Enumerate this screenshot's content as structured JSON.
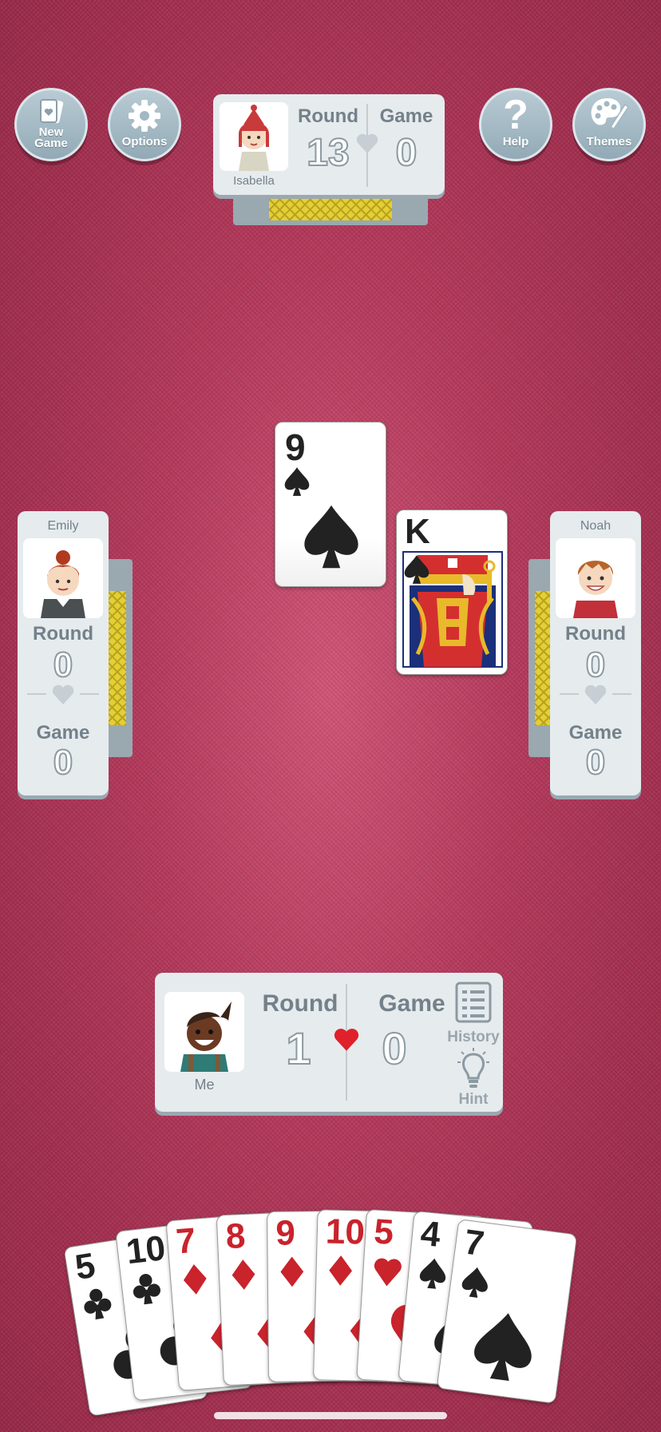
{
  "buttons": {
    "new_game": "New\nGame",
    "options": "Options",
    "help": "Help",
    "themes": "Themes"
  },
  "labels": {
    "round": "Round",
    "game": "Game"
  },
  "players": {
    "top": {
      "name": "Isabella",
      "round": "13",
      "game": "0"
    },
    "left": {
      "name": "Emily",
      "round": "0",
      "game": "0"
    },
    "right": {
      "name": "Noah",
      "round": "0",
      "game": "0"
    },
    "me": {
      "name": "Me",
      "round": "1",
      "game": "0",
      "history": "History",
      "hint": "Hint"
    }
  },
  "played_cards": [
    {
      "rank": "9",
      "suit": "spades"
    },
    {
      "rank": "K",
      "suit": "spades"
    }
  ],
  "hand": [
    {
      "rank": "5",
      "suit": "clubs"
    },
    {
      "rank": "10",
      "suit": "clubs"
    },
    {
      "rank": "7",
      "suit": "diamonds"
    },
    {
      "rank": "8",
      "suit": "diamonds"
    },
    {
      "rank": "9",
      "suit": "diamonds"
    },
    {
      "rank": "10",
      "suit": "diamonds"
    },
    {
      "rank": "5",
      "suit": "hearts"
    },
    {
      "rank": "4",
      "suit": "spades"
    },
    {
      "rank": "7",
      "suit": "spades"
    }
  ],
  "colors": {
    "felt": "#b33a5c",
    "heart_active": "#e0202a",
    "heart_inactive": "#c7cfd4",
    "card_back": "#e4cf33"
  }
}
